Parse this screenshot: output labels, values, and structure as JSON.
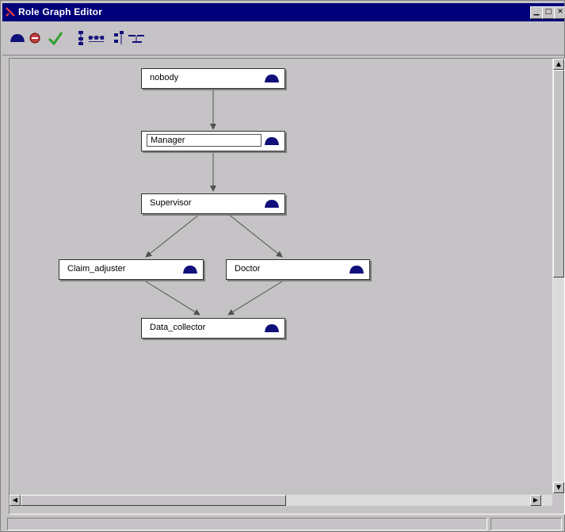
{
  "window": {
    "title": "Role Graph Editor",
    "controls": [
      "minimize",
      "maximize",
      "close"
    ]
  },
  "toolbar": {
    "tools": [
      {
        "name": "add-role",
        "icon": "role-hat-icon"
      },
      {
        "name": "delete-role",
        "icon": "delete-icon"
      },
      {
        "name": "validate",
        "icon": "checkmark-icon"
      },
      {
        "name": "layout-vertical",
        "icon": "layout-vertical-icon"
      },
      {
        "name": "layout-horizontal",
        "icon": "layout-horizontal-icon"
      },
      {
        "name": "connect-vertical",
        "icon": "connect-vertical-icon"
      },
      {
        "name": "connect-horizontal",
        "icon": "connect-horizontal-icon"
      }
    ]
  },
  "graph": {
    "nodes": [
      {
        "id": "nobody",
        "label": "nobody"
      },
      {
        "id": "manager",
        "label": "Manager"
      },
      {
        "id": "supervisor",
        "label": "Supervisor"
      },
      {
        "id": "claim_adjuster",
        "label": "Claim_adjuster"
      },
      {
        "id": "doctor",
        "label": "Doctor"
      },
      {
        "id": "data_collector",
        "label": "Data_collector"
      }
    ],
    "edges": [
      [
        "nobody",
        "manager"
      ],
      [
        "manager",
        "supervisor"
      ],
      [
        "supervisor",
        "claim_adjuster"
      ],
      [
        "supervisor",
        "doctor"
      ],
      [
        "claim_adjuster",
        "data_collector"
      ],
      [
        "doctor",
        "data_collector"
      ]
    ],
    "selected_node": "manager"
  },
  "colors": {
    "title_bar": "#00007a",
    "icon_navy": "#10107a",
    "canvas_bg": "#c6c3c6",
    "node_bg": "#ffffff",
    "edge": "#505050"
  }
}
